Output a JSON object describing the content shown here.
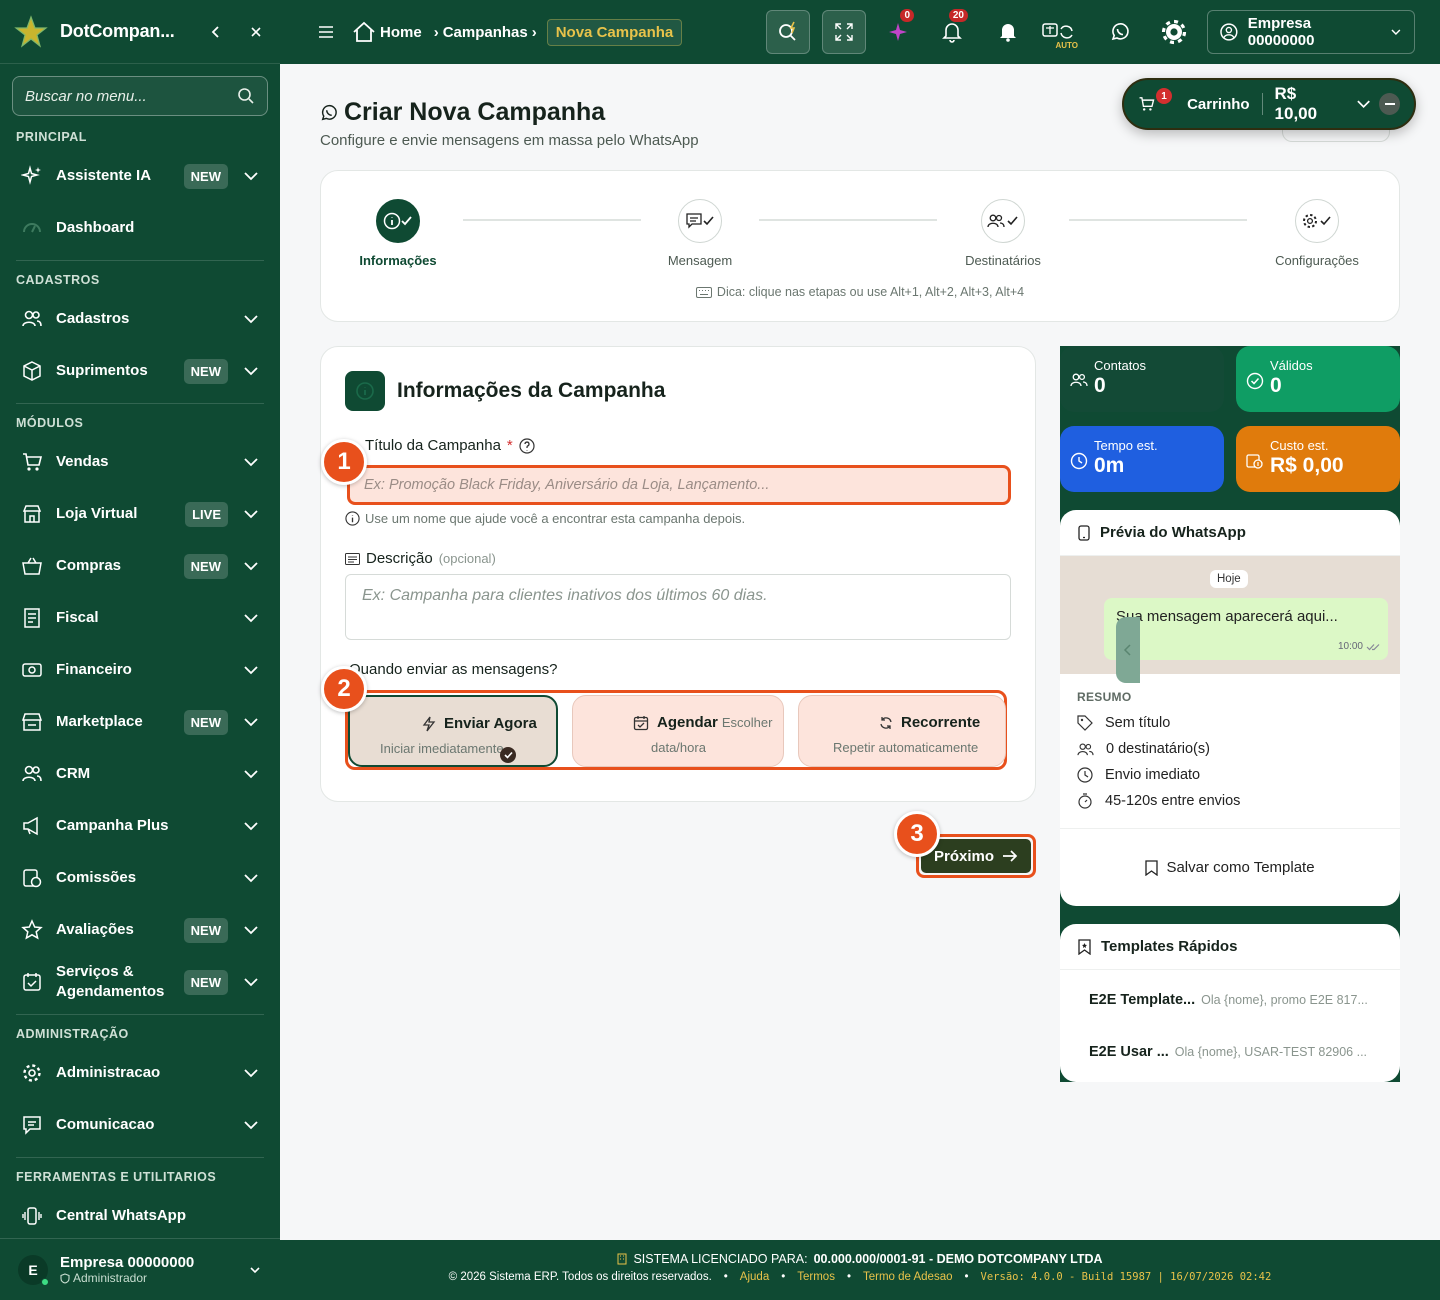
{
  "app": {
    "brand": "DotCompan..."
  },
  "sidebar": {
    "search_placeholder": "Buscar no menu...",
    "sections": {
      "principal": "PRINCIPAL",
      "cadastros": "CADASTROS",
      "modulos": "MÓDULOS",
      "administracao": "ADMINISTRAÇÃO",
      "ferramentas": "FERRAMENTAS E UTILITARIOS"
    },
    "items": [
      {
        "label": "Assistente IA",
        "badge": "NEW"
      },
      {
        "label": "Dashboard"
      },
      {
        "label": "Cadastros"
      },
      {
        "label": "Suprimentos",
        "badge": "NEW"
      },
      {
        "label": "Vendas"
      },
      {
        "label": "Loja Virtual",
        "badge": "LIVE"
      },
      {
        "label": "Compras",
        "badge": "NEW"
      },
      {
        "label": "Fiscal"
      },
      {
        "label": "Financeiro"
      },
      {
        "label": "Marketplace",
        "badge": "NEW"
      },
      {
        "label": "CRM"
      },
      {
        "label": "Campanha Plus"
      },
      {
        "label": "Comissões"
      },
      {
        "label": "Avaliações",
        "badge": "NEW"
      },
      {
        "label": "Serviços & Agendamentos",
        "badge": "NEW"
      },
      {
        "label": "Administracao"
      },
      {
        "label": "Comunicacao"
      },
      {
        "label": "Central WhatsApp"
      }
    ],
    "user": {
      "initial": "E",
      "name": "Empresa 00000000",
      "role": "Administrador"
    }
  },
  "topbar": {
    "breadcrumb": {
      "home": "Home",
      "campanhas": "Campanhas",
      "current": "Nova Campanha"
    },
    "ai_count": "0",
    "notif_count": "20",
    "auto_label": "AUTO",
    "company": "Empresa 00000000"
  },
  "cart": {
    "count": "1",
    "label": "Carrinho",
    "total": "R$ 10,00"
  },
  "page": {
    "title": "Criar Nova Campanha",
    "subtitle": "Configure e envie mensagens em massa pelo WhatsApp"
  },
  "steps": [
    {
      "label": "Informações"
    },
    {
      "label": "Mensagem"
    },
    {
      "label": "Destinatários"
    },
    {
      "label": "Configurações"
    }
  ],
  "steps_hint": "Dica: clique nas etapas ou use Alt+1, Alt+2, Alt+3, Alt+4",
  "form": {
    "card_title": "Informações da Campanha",
    "title_label": "Título da Campanha",
    "required_mark": "*",
    "title_placeholder": "Ex: Promoção Black Friday, Aniversário da Loja, Lançamento...",
    "title_help": "Use um nome que ajude você a encontrar esta campanha depois.",
    "desc_label": "Descrição",
    "desc_optional": "(opcional)",
    "desc_placeholder": "Ex: Campanha para clientes inativos dos últimos 60 dias.",
    "when_label": "Quando enviar as mensagens?",
    "modes": [
      {
        "title": "Enviar Agora",
        "sub": "Iniciar imediatamente",
        "selected": true
      },
      {
        "title": "Agendar",
        "title_extra": "Escolher",
        "sub": "data/hora",
        "selected": false
      },
      {
        "title": "Recorrente",
        "sub": "Repetir automaticamente",
        "selected": false
      }
    ],
    "next_label": "Próximo"
  },
  "markers": [
    "1",
    "2",
    "3"
  ],
  "stats": {
    "contatos": {
      "label": "Contatos",
      "value": "0",
      "color": "#134a36"
    },
    "validos": {
      "label": "Válidos",
      "value": "0",
      "color": "#0f9d64"
    },
    "tempo": {
      "label": "Tempo est.",
      "value": "0m",
      "color": "#1f5fe0"
    },
    "custo": {
      "label": "Custo est.",
      "value": "R$ 0,00",
      "color": "#e07b0c"
    }
  },
  "preview": {
    "title": "Prévia do WhatsApp",
    "day": "Hoje",
    "message": "Sua mensagem aparecerá aqui...",
    "time": "10:00",
    "summary_title": "RESUMO",
    "summary": [
      "Sem título",
      "0 destinatário(s)",
      "Envio imediato",
      "45-120s entre envios"
    ],
    "save_template": "Salvar como Template"
  },
  "templates": {
    "title": "Templates Rápidos",
    "items": [
      {
        "name": "E2E Template...",
        "preview": "Ola {nome}, promo E2E 817..."
      },
      {
        "name": "E2E Usar ...",
        "preview": "Ola {nome}, USAR-TEST 82906 ..."
      }
    ]
  },
  "footer": {
    "license_prefix": "SISTEMA LICENCIADO PARA:",
    "license_value": "00.000.000/0001-91 - DEMO DOTCOMPANY LTDA",
    "copyright": "© 2026 Sistema ERP. Todos os direitos reservados.",
    "links": [
      "Ajuda",
      "Termos",
      "Termo de Adesao"
    ],
    "version": "Versão: 4.0.0 - Build 15987 | 16/07/2026 02:42"
  },
  "colors": {
    "brand": "#0f4a33",
    "accent": "#e8501c",
    "gold": "#e8c24a"
  }
}
